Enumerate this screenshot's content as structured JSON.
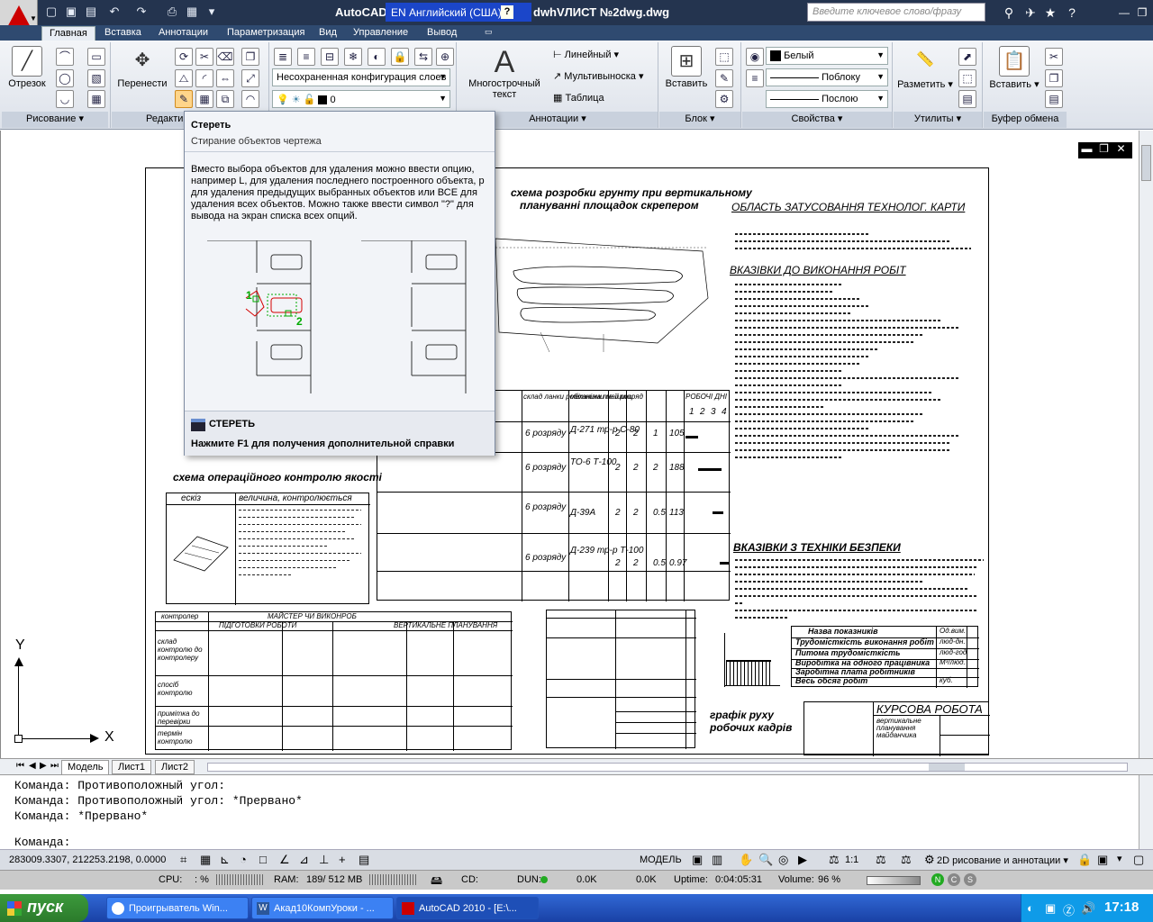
{
  "app": {
    "title": "AutoCAD",
    "title_suffix": "dwhVЛИСТ №2dwg.dwg",
    "language_indicator": "EN Английский (США)",
    "search_placeholder": "Введите ключевое слово/фразу"
  },
  "ribbon": {
    "tabs": [
      "Главная",
      "Вставка",
      "Аннотации",
      "Параметризация",
      "Вид",
      "Управление",
      "Вывод"
    ],
    "active_tab": "Главная",
    "panels": {
      "draw": {
        "footer": "Рисование",
        "line_label": "Отрезок"
      },
      "modify": {
        "footer": "Редакти",
        "move_label": "Перенести"
      },
      "layers": {
        "layer_state": "Несохраненная конфигурация слоев",
        "current_layer": "0"
      },
      "annotation": {
        "footer": "Аннотации",
        "mtext_label_1": "Многострочный",
        "mtext_label_2": "текст",
        "linear": "Линейный",
        "multileader": "Мультивыноска",
        "table": "Таблица"
      },
      "block": {
        "footer": "Блок",
        "insert_label": "Вставить"
      },
      "properties": {
        "footer": "Свойства",
        "color": "Белый",
        "linetype": "Поблоку",
        "lineweight": "Послою"
      },
      "utilities": {
        "footer": "Утилиты",
        "measure_label": "Разметить"
      },
      "clipboard": {
        "footer": "Буфер обмена",
        "paste_label": "Вставить"
      }
    }
  },
  "tooltip": {
    "title": "Стереть",
    "subtitle": "Стирание объектов чертежа",
    "body": "Вместо выбора объектов для удаления можно ввести опцию, например L, для удаления последнего построенного объекта, p для удаления предыдущих выбранных объектов или ВСЕ для удаления всех объектов. Можно также ввести символ \"?\" для вывода на экран списка всех опций.",
    "marker_1": "1",
    "marker_2": "2",
    "command": "СТЕРЕТЬ",
    "help_hint": "Нажмите F1 для получения дополнительной справки"
  },
  "drawing": {
    "heading_1": "схема розробки грунту при вертикальному",
    "heading_2": "плануванні площадок скрепером",
    "area_title": "ОБЛАСТЬ ЗАТУСОВАННЯ ТЕХНОЛОГ. КАРТИ",
    "instructions_title": "ВКАЗІВКИ ДО ВИКОНАННЯ РОБІТ",
    "safety_title": "ВКАЗІВКИ З ТЕХНІКИ БЕЗПЕКИ",
    "control_title": "схема операційного контролю якості",
    "control_col_1": "ескіз",
    "control_col_2": "величина, контролюється",
    "chart_title_1": "графік руху",
    "chart_title_2": "робочих кадрів",
    "stamp_title": "КУРСОВА РОБОТА",
    "stamp_sub_1": "вертикальне",
    "stamp_sub_2": "планування",
    "stamp_sub_3": "майданчика",
    "indicators_title": "Назва показників",
    "indicators": [
      "Трудомісткість виконання робіт",
      "Питома трудомісткість",
      "Виробітка на одного працівника",
      "Заробітна плата робітників",
      "Весь обсяг робіт"
    ],
    "indicator_units": [
      "Од.вим.",
      "люд-дн.",
      "люд-год",
      "М³/люд.",
      "",
      "куб."
    ],
    "control_table_title": "контролер",
    "control_table_stages": "ПІДГОТОВКИ РОБОТИ",
    "control_table_main": "ВЕРТИКАЛЬНЕ ПЛАНУВАННЯ",
    "master_title": "МАЙСТЕР ЧИ ВИКОНРОБ",
    "row_labels": [
      "склад контролю до контролеру",
      "спосіб контролю",
      "примітка до перевірки",
      "термін контролю"
    ],
    "machines": [
      "Д-271 тр-р С-80",
      "ТО-6 Т-100",
      "Д-39А",
      "Д-239 тр-р Т-100"
    ],
    "crew_grade": "6 розряду",
    "work_table_headers": [
      "склад ланки робітника та її розряд",
      "механізми машини",
      "РЕ-ЗНИ",
      "К-СТЬ МАШ.",
      "ВИРОБ",
      "ТРУД",
      "ПІДН",
      "РОБОЧІ ДНІ"
    ],
    "day_numbers": [
      "1",
      "2",
      "3",
      "4"
    ],
    "work_values": [
      [
        "2",
        "2",
        "1",
        "105"
      ],
      [
        "2",
        "2",
        "2",
        "188"
      ],
      [
        "2",
        "2",
        "0.5",
        "113"
      ],
      [
        "2",
        "2",
        "0.5",
        "0.97"
      ]
    ],
    "axis_y": "Y",
    "axis_x": "X"
  },
  "layout_tabs": [
    "Модель",
    "Лист1",
    "Лист2"
  ],
  "command_line": {
    "history": [
      "Команда: Противоположный угол:",
      "Команда: Противоположный угол: *Прервано*",
      "Команда: *Прервано*"
    ],
    "prompt": "Команда:"
  },
  "status_bar": {
    "coordinates": "283009.3307, 212253.2198, 0.0000",
    "model_label": "МОДЕЛЬ",
    "scale": "1:1",
    "workspace": "2D рисование и аннотации"
  },
  "perf_bar": {
    "cpu_label": "CPU:",
    "cpu_value": ": %",
    "ram_label": "RAM:",
    "ram_value": "189/ 512 MB",
    "cd_label": "CD:",
    "dun_label": "DUN:",
    "dun_value_1": "0.0K",
    "dun_value_2": "0.0K",
    "uptime_label": "Uptime:",
    "uptime_value": "0:04:05:31",
    "volume_label": "Volume:",
    "volume_value": "96 %"
  },
  "taskbar": {
    "start": "пуск",
    "tasks": [
      "Проигрыватель Win...",
      "Акад10КомпУроки - ...",
      "AutoCAD 2010 - [E:\\..."
    ],
    "active_task": 2,
    "clock": "17:18"
  },
  "colors": {
    "titlebar": "#24344f",
    "ribbon_tab_bg": "#2f4a70",
    "taskbar": "#245edb",
    "start": "#3c9a3c",
    "autocad_red": "#cc0000"
  }
}
